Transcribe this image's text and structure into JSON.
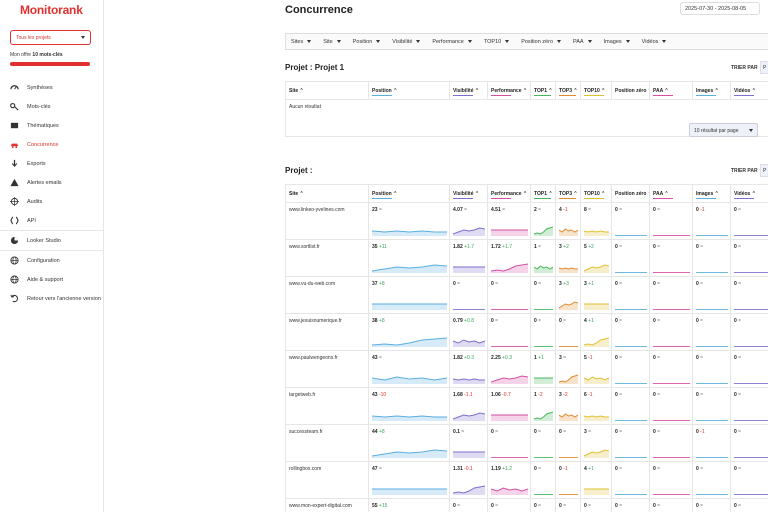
{
  "app": {
    "logo": "Monitorank"
  },
  "sidebar": {
    "project_select": "Tous les projets",
    "offer_label": "Mon offre",
    "offer_value": "10 mots-clés",
    "items": [
      {
        "label": "Synthèses",
        "icon": "gauge-icon"
      },
      {
        "label": "Mots-clés",
        "icon": "key-icon"
      },
      {
        "label": "Thématiques",
        "icon": "folder-icon"
      },
      {
        "label": "Concurrence",
        "icon": "car-icon",
        "active": true
      },
      {
        "label": "Exports",
        "icon": "download-icon"
      },
      {
        "label": "Alertes emails",
        "icon": "alert-icon"
      },
      {
        "label": "Audits",
        "icon": "target-icon"
      },
      {
        "label": "API",
        "icon": "code-icon"
      },
      {
        "label": "Looker Studio",
        "icon": "pie-icon"
      },
      {
        "label": "Configuration",
        "icon": "globe-icon"
      },
      {
        "label": "Aide & support",
        "icon": "help-globe-icon"
      },
      {
        "label": "Retour vers l'ancienne version",
        "icon": "undo-icon"
      }
    ]
  },
  "header": {
    "title": "Concurrence",
    "date_range": "2025-07-30 - 2025-08-05"
  },
  "filters": [
    "Sites",
    "Site",
    "Position",
    "Visibilité",
    "Performance",
    "TOP10",
    "Position zéro",
    "PAA",
    "Images",
    "Vidéos"
  ],
  "colors": {
    "accent": "#e0312f",
    "position": "#5aaee0",
    "visibilite": "#7b6fd0",
    "performance": "#d64fa5",
    "top1": "#46b85a",
    "top3": "#e08a2e",
    "top10": "#e0c02e",
    "paa": "#d64fa5",
    "images": "#5aaee0",
    "videos": "#7b6fd0"
  },
  "columns": [
    "Site",
    "Position",
    "Visibilité",
    "Performance",
    "TOP1",
    "TOP3",
    "TOP10",
    "Position zéro",
    "PAA",
    "Images",
    "Vidéos"
  ],
  "project1": {
    "title": "Projet : Projet 1",
    "sort_label": "TRIER PAR",
    "page_btn": "P",
    "empty": "Aucun résultat",
    "per_page": "10 résultat par page"
  },
  "project2": {
    "title": "Projet :",
    "sort_label": "TRIER PAR",
    "page_btn": "P"
  },
  "rows": [
    {
      "site": "www.linkeo-yvelines.com",
      "position": "23",
      "position_d": "=",
      "visibilite": "4.07",
      "visibilite_d": "=",
      "performance": "4.51",
      "performance_d": "=",
      "top1": "2",
      "top1_d": "=",
      "top3": "4",
      "top3_d": "-1",
      "top10": "8",
      "top10_d": "=",
      "pz": "0",
      "pz_d": "=",
      "paa": "0",
      "paa_d": "=",
      "images": "0",
      "images_d": "-1",
      "videos": "0",
      "videos_d": "="
    },
    {
      "site": "www.sortlist.fr",
      "position": "35",
      "position_d": "+11",
      "visibilite": "1.82",
      "visibilite_d": "+1.7",
      "performance": "1.72",
      "performance_d": "+1.7",
      "top1": "1",
      "top1_d": "=",
      "top3": "3",
      "top3_d": "+2",
      "top10": "5",
      "top10_d": "+2",
      "pz": "0",
      "pz_d": "=",
      "paa": "0",
      "paa_d": "=",
      "images": "0",
      "images_d": "=",
      "videos": "0",
      "videos_d": "="
    },
    {
      "site": "www.vu-du-web.com",
      "position": "37",
      "position_d": "+8",
      "visibilite": "0",
      "visibilite_d": "=",
      "performance": "0",
      "performance_d": "=",
      "top1": "0",
      "top1_d": "=",
      "top3": "3",
      "top3_d": "+3",
      "top10": "3",
      "top10_d": "+1",
      "pz": "0",
      "pz_d": "=",
      "paa": "0",
      "paa_d": "=",
      "images": "0",
      "images_d": "=",
      "videos": "0",
      "videos_d": "="
    },
    {
      "site": "www.jesuisnumerique.fr",
      "position": "38",
      "position_d": "+8",
      "visibilite": "0.79",
      "visibilite_d": "+0.8",
      "performance": "0",
      "performance_d": "=",
      "top1": "0",
      "top1_d": "=",
      "top3": "0",
      "top3_d": "=",
      "top10": "4",
      "top10_d": "+1",
      "pz": "0",
      "pz_d": "=",
      "paa": "0",
      "paa_d": "=",
      "images": "0",
      "images_d": "=",
      "videos": "0",
      "videos_d": "="
    },
    {
      "site": "www.paulwengeons.fr",
      "position": "43",
      "position_d": "=",
      "visibilite": "1.82",
      "visibilite_d": "+0.3",
      "performance": "2.25",
      "performance_d": "+0.3",
      "top1": "1",
      "top1_d": "+1",
      "top3": "3",
      "top3_d": "=",
      "top10": "5",
      "top10_d": "-1",
      "pz": "0",
      "pz_d": "=",
      "paa": "0",
      "paa_d": "=",
      "images": "0",
      "images_d": "=",
      "videos": "0",
      "videos_d": "="
    },
    {
      "site": "targetweb.fr",
      "position": "43",
      "position_d": "-10",
      "visibilite": "1.68",
      "visibilite_d": "-1.1",
      "performance": "1.06",
      "performance_d": "-0.7",
      "top1": "1",
      "top1_d": "-2",
      "top3": "3",
      "top3_d": "-2",
      "top10": "6",
      "top10_d": "-1",
      "pz": "0",
      "pz_d": "=",
      "paa": "0",
      "paa_d": "=",
      "images": "0",
      "images_d": "=",
      "videos": "0",
      "videos_d": "="
    },
    {
      "site": "successteam.fr",
      "position": "44",
      "position_d": "+8",
      "visibilite": "0.1",
      "visibilite_d": "=",
      "performance": "0",
      "performance_d": "=",
      "top1": "0",
      "top1_d": "=",
      "top3": "0",
      "top3_d": "=",
      "top10": "3",
      "top10_d": "=",
      "pz": "0",
      "pz_d": "=",
      "paa": "0",
      "paa_d": "=",
      "images": "0",
      "images_d": "-1",
      "videos": "0",
      "videos_d": "="
    },
    {
      "site": "rollingbox.com",
      "position": "47",
      "position_d": "=",
      "visibilite": "1.31",
      "visibilite_d": "-0.1",
      "performance": "1.19",
      "performance_d": "+1.2",
      "top1": "0",
      "top1_d": "=",
      "top3": "0",
      "top3_d": "-1",
      "top10": "4",
      "top10_d": "+1",
      "pz": "0",
      "pz_d": "=",
      "paa": "0",
      "paa_d": "=",
      "images": "0",
      "images_d": "=",
      "videos": "0",
      "videos_d": "="
    },
    {
      "site": "www.mon-expert-digital.com",
      "position": "55",
      "position_d": "+15",
      "visibilite": "0",
      "visibilite_d": "=",
      "performance": "0",
      "performance_d": "=",
      "top1": "0",
      "top1_d": "=",
      "top3": "0",
      "top3_d": "=",
      "top10": "0",
      "top10_d": "=",
      "pz": "0",
      "pz_d": "=",
      "paa": "0",
      "paa_d": "=",
      "images": "0",
      "images_d": "=",
      "videos": "0",
      "videos_d": "="
    }
  ]
}
